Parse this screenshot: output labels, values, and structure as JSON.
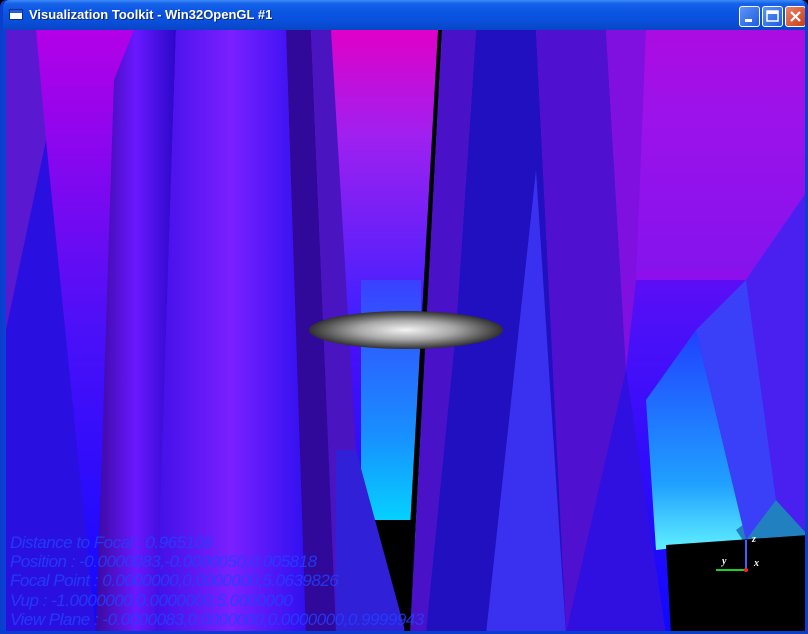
{
  "window": {
    "title": "Visualization Toolkit - Win32OpenGL #1"
  },
  "titlebar_buttons": [
    "minimize",
    "maximize",
    "close"
  ],
  "readout": {
    "lines": [
      "Distance to Focal : 0.965108",
      "Position : -0.0000083,-0.0000050,0.005818",
      "Focal Point : 0.0000000,0.0000000,5.0639826",
      "Vup : -1.0000000,0.0000000,5.0000000",
      "View Plane : -0.0000083,0.0000000,0.0000000,0.9999943"
    ]
  },
  "orientation_axes": {
    "labels": {
      "x": "x",
      "y": "y",
      "z": "z"
    },
    "colors": {
      "x": "#ff2020",
      "y": "#20d020",
      "z": "#4060ff"
    }
  },
  "colors": {
    "titlebar": "#0b55e3",
    "scene_magenta": "#d400d8",
    "scene_blue": "#1a10ff",
    "scene_cyan": "#00d8ff",
    "text_blue": "#2040ff"
  }
}
